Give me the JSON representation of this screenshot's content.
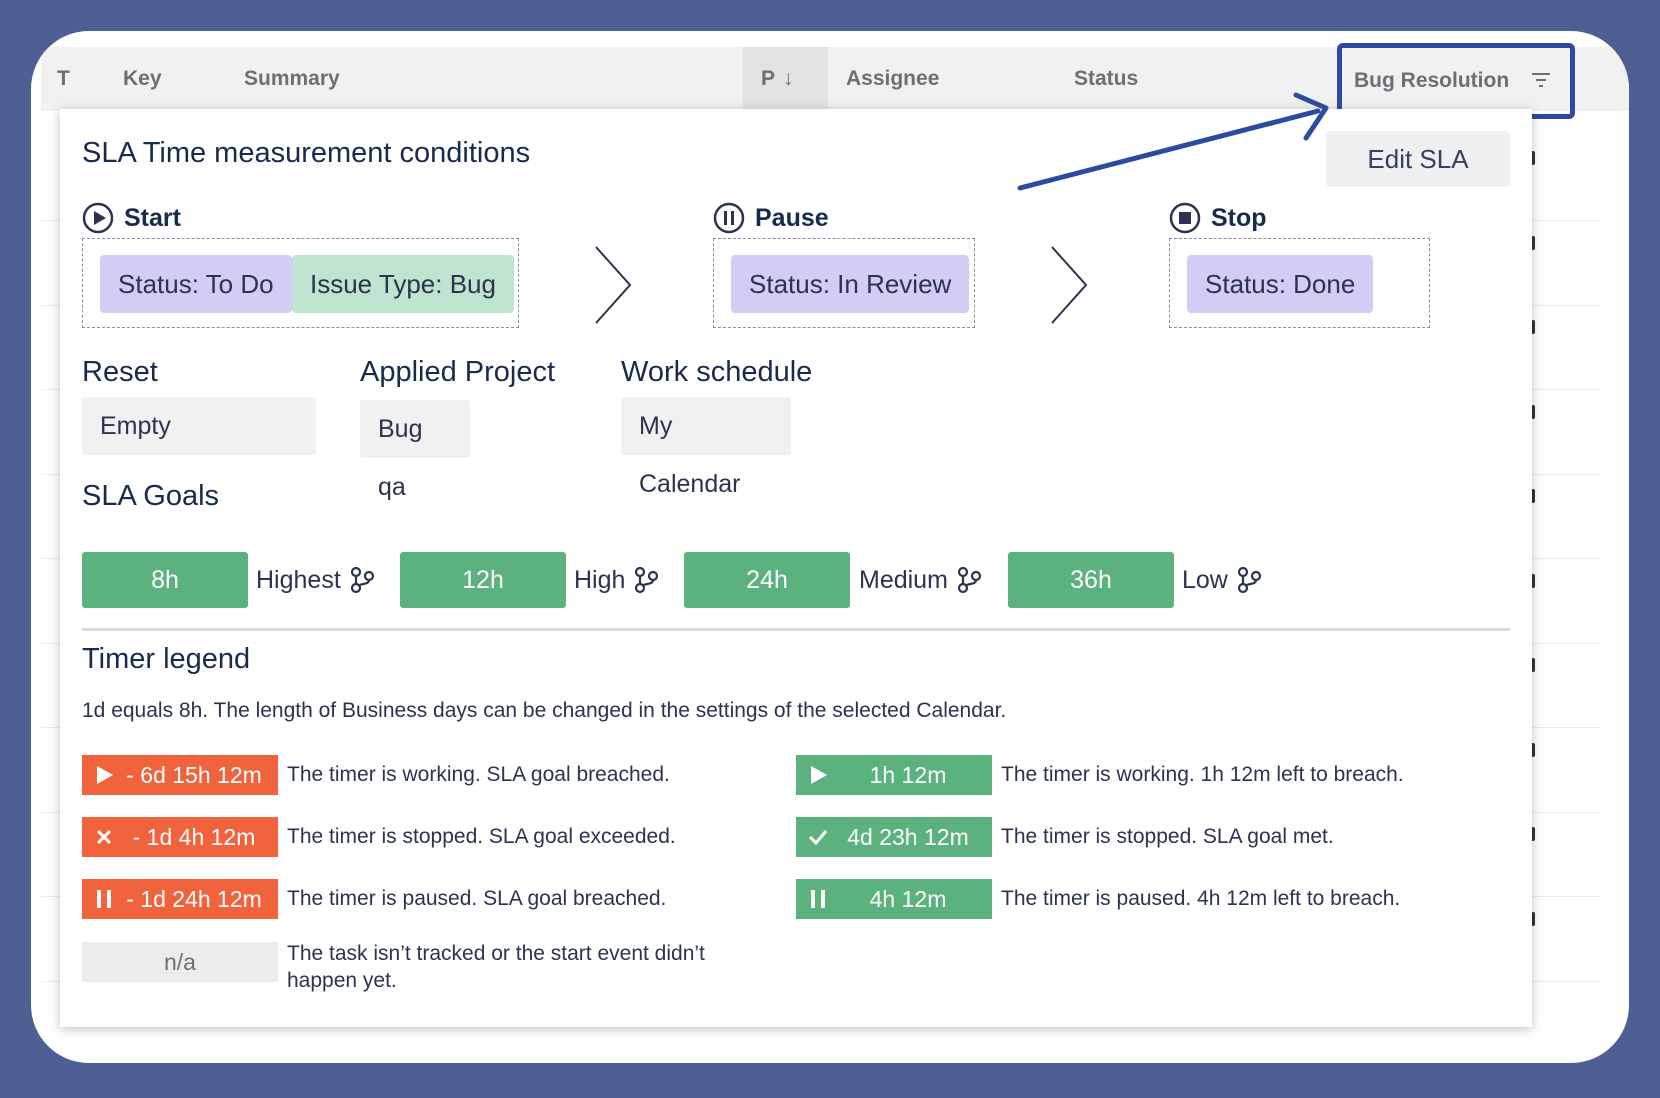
{
  "table": {
    "columns": [
      "T",
      "Key",
      "Summary",
      "P",
      "Assignee",
      "Status"
    ],
    "highlighted_column": "Bug Resolution",
    "sort_arrow": "↓"
  },
  "popup": {
    "title": "SLA Time measurement conditions",
    "edit_button": "Edit SLA",
    "phases": {
      "start": {
        "label": "Start",
        "chips": [
          "Status:  To Do",
          "Issue Type:  Bug"
        ]
      },
      "pause": {
        "label": "Pause",
        "chips": [
          "Status:  In Review"
        ]
      },
      "stop": {
        "label": "Stop",
        "chips": [
          "Status:  Done"
        ]
      }
    },
    "reset": {
      "label": "Reset",
      "value": "Empty"
    },
    "applied_project": {
      "label": "Applied Project",
      "value": "Bug qa"
    },
    "work_schedule": {
      "label": "Work schedule",
      "value": "My Calendar"
    },
    "sla_goals": {
      "label": "SLA Goals",
      "goals": [
        {
          "time": "8h",
          "priority": "Highest"
        },
        {
          "time": "12h",
          "priority": "High"
        },
        {
          "time": "24h",
          "priority": "Medium"
        },
        {
          "time": "36h",
          "priority": "Low"
        }
      ]
    },
    "timer_legend": {
      "label": "Timer legend",
      "description": "1d equals 8h. The length of Business days can be changed in the settings of the selected Calendar.",
      "items": [
        {
          "badge": "- 6d 15h 12m",
          "text": "The timer is working. SLA goal breached.",
          "color": "#f1633d",
          "icon": "play-icon"
        },
        {
          "badge": "- 1d 4h 12m",
          "text": "The timer is stopped. SLA goal exceeded.",
          "color": "#f1633d",
          "icon": "cross-icon"
        },
        {
          "badge": "- 1d 24h 12m",
          "text": "The timer is paused. SLA goal breached.",
          "color": "#f1633d",
          "icon": "pause-icon"
        },
        {
          "badge": "n/a",
          "text": "The task isn’t tracked or the start event didn’t happen yet.",
          "color": "#ececec"
        },
        {
          "badge": "1h 12m",
          "text": "The timer is working. 1h 12m left to breach.",
          "color": "#5cb27f",
          "icon": "play-icon"
        },
        {
          "badge": "4d 23h 12m",
          "text": "The timer is stopped. SLA goal met.",
          "color": "#5cb27f",
          "icon": "check-icon"
        },
        {
          "badge": "4h 12m",
          "text": "The timer is paused. 4h 12m left to breach.",
          "color": "#5cb27f",
          "icon": "pause-icon"
        }
      ]
    }
  },
  "colors": {
    "background": "#4f5f93",
    "highlight_border": "#2e4aa0",
    "goal_green": "#5cb27f",
    "breach_red": "#f1633d",
    "chip_purple": "#d3ccf4",
    "chip_green": "#bfe4cf"
  }
}
